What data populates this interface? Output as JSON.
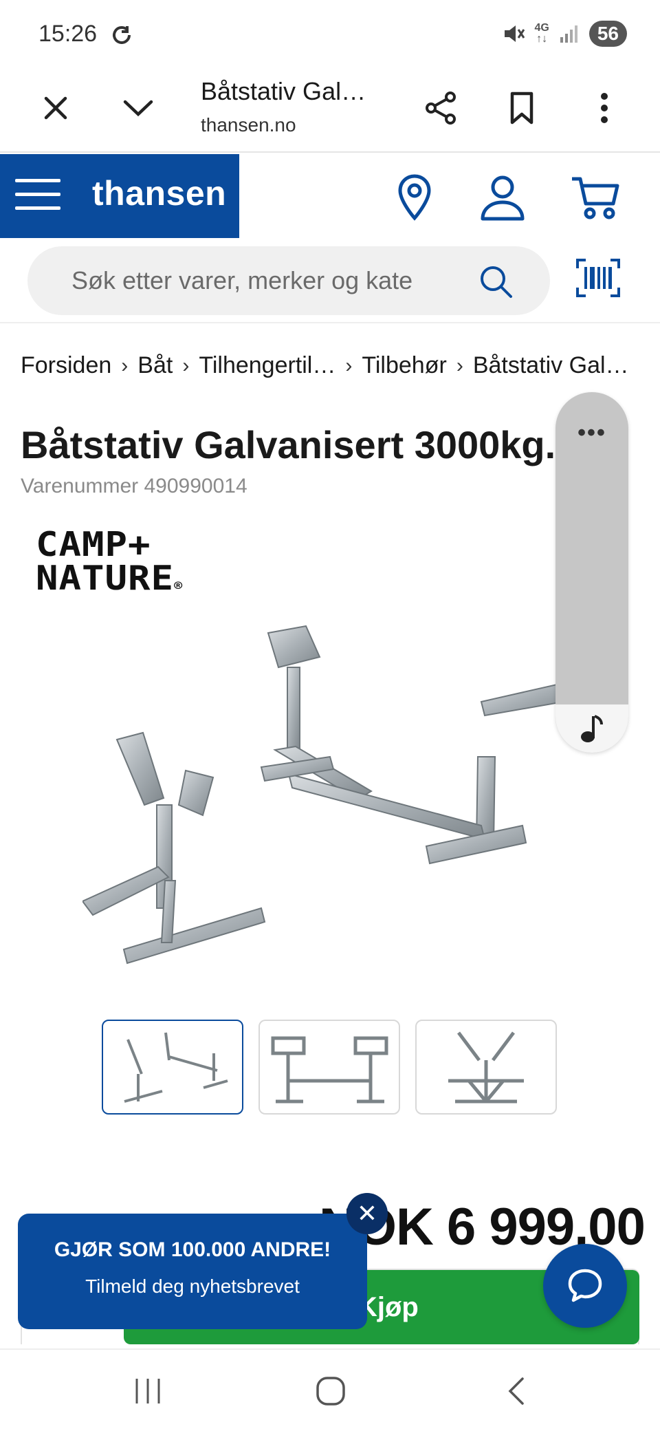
{
  "status": {
    "time": "15:26",
    "network": "4G",
    "battery": "56"
  },
  "browser": {
    "tab_title": "Båtstativ Gal…",
    "url": "thansen.no"
  },
  "header": {
    "logo": "thansen"
  },
  "search": {
    "placeholder": "Søk etter varer, merker og kate"
  },
  "breadcrumb": [
    {
      "label": "Forsiden"
    },
    {
      "label": "Båt"
    },
    {
      "label": "Tilhengertil…"
    },
    {
      "label": "Tilbehør"
    },
    {
      "label": "Båtstativ Gal…"
    }
  ],
  "product": {
    "title": "Båtstativ Galvanisert 3000kg.",
    "sku": "Varenummer 490990014",
    "brand_line1": "CAMP+",
    "brand_line2": "NATURE",
    "brand_mark": "®",
    "price": "NOK 6 999,00",
    "buy_label": "Kjøp"
  },
  "floating_panel": {
    "dots": "•••"
  },
  "newsletter": {
    "title": "GJØR SOM 100.000 ANDRE!",
    "subtitle": "Tilmeld deg nyhetsbrevet",
    "close": "✕"
  },
  "colors": {
    "brand": "#0a4b9c",
    "buy": "#1e9b3b"
  }
}
